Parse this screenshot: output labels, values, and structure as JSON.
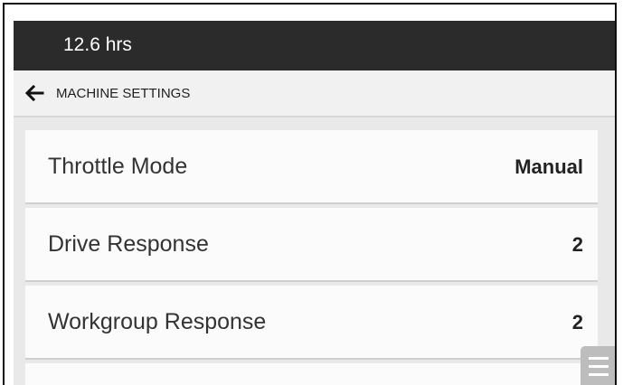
{
  "status_bar": {
    "hours": "12.6 hrs"
  },
  "header": {
    "title": "MACHINE SETTINGS",
    "back_icon": "arrow-left-icon"
  },
  "settings": [
    {
      "label": "Throttle Mode",
      "value": "Manual"
    },
    {
      "label": "Drive Response",
      "value": "2"
    },
    {
      "label": "Workgroup Response",
      "value": "2"
    },
    {
      "label": "",
      "value": ""
    }
  ],
  "menu_button": {
    "icon": "menu-icon"
  },
  "colors": {
    "status_bar": "#2b2b2b",
    "background": "#e9e9e9",
    "row_background": "#fbfbfb",
    "menu_button": "#bdbdbd"
  }
}
